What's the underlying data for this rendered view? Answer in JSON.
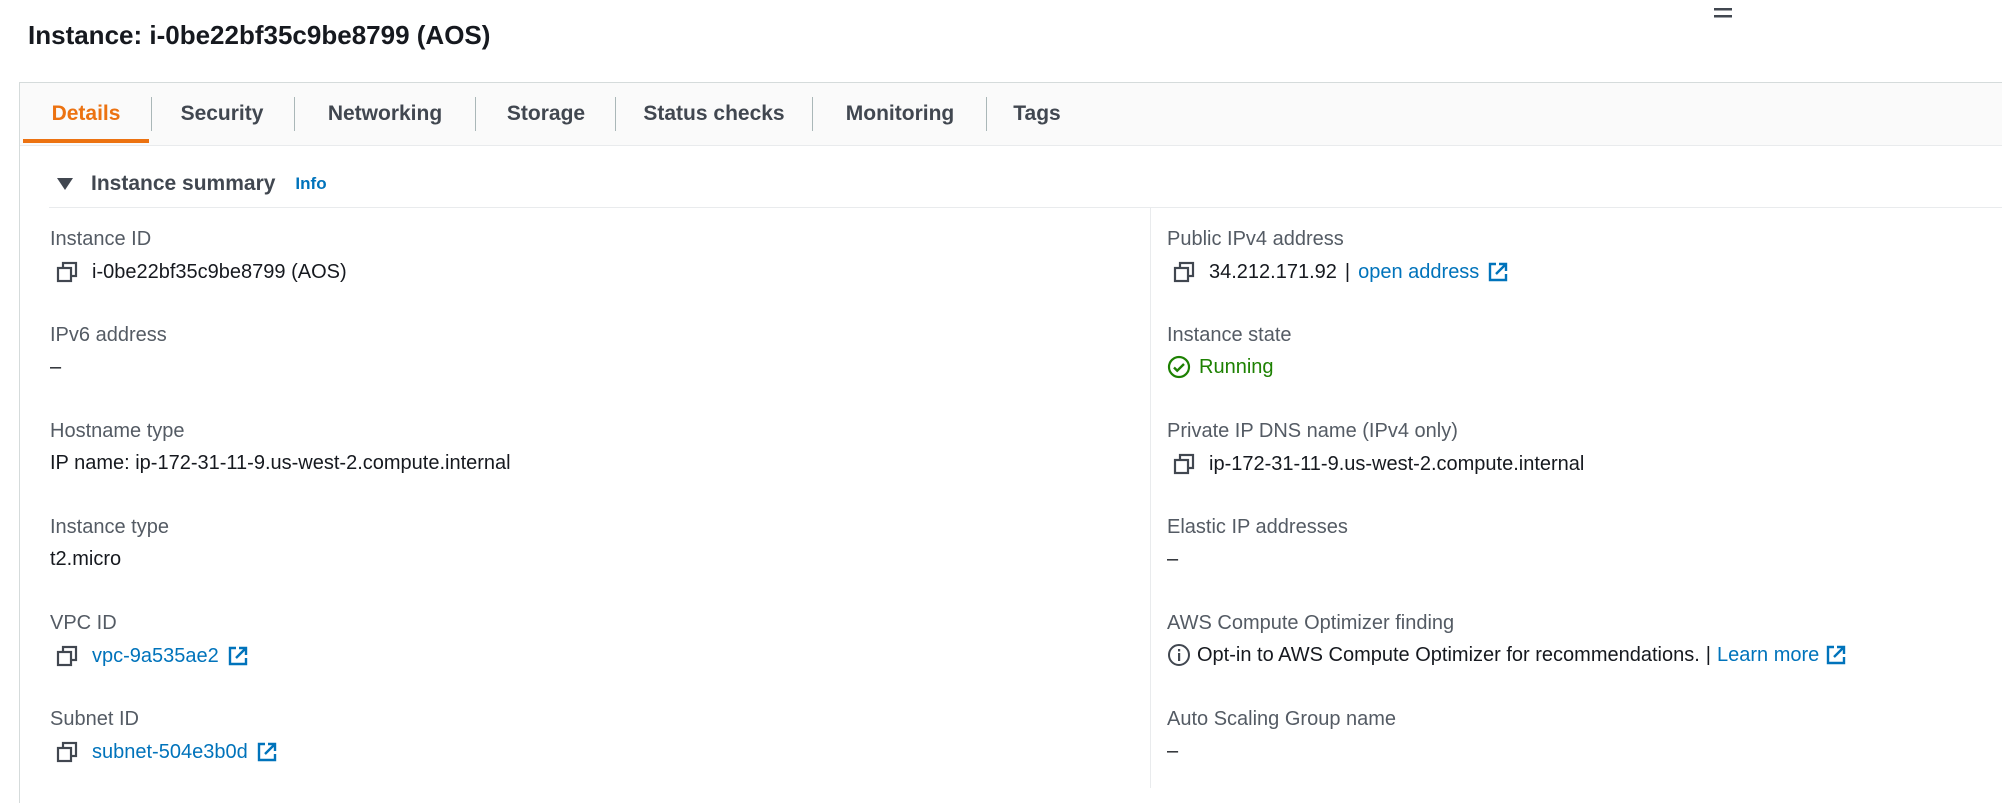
{
  "page": {
    "title": "Instance: i-0be22bf35c9be8799 (AOS)"
  },
  "tabs": [
    {
      "label": "Details",
      "active": true
    },
    {
      "label": "Security",
      "active": false
    },
    {
      "label": "Networking",
      "active": false
    },
    {
      "label": "Storage",
      "active": false
    },
    {
      "label": "Status checks",
      "active": false
    },
    {
      "label": "Monitoring",
      "active": false
    },
    {
      "label": "Tags",
      "active": false
    }
  ],
  "summary": {
    "title": "Instance summary",
    "info": "Info"
  },
  "left": {
    "instance_id": {
      "label": "Instance ID",
      "value": "i-0be22bf35c9be8799 (AOS)"
    },
    "ipv6": {
      "label": "IPv6 address",
      "value": "–"
    },
    "hostname_type": {
      "label": "Hostname type",
      "value": "IP name: ip-172-31-11-9.us-west-2.compute.internal"
    },
    "instance_type": {
      "label": "Instance type",
      "value": "t2.micro"
    },
    "vpc": {
      "label": "VPC ID",
      "value": "vpc-9a535ae2"
    },
    "subnet": {
      "label": "Subnet ID",
      "value": "subnet-504e3b0d"
    }
  },
  "right": {
    "public_ipv4": {
      "label": "Public IPv4 address",
      "value": "34.212.171.92",
      "separator": "|",
      "link": "open address"
    },
    "state": {
      "label": "Instance state",
      "value": "Running"
    },
    "private_dns": {
      "label": "Private IP DNS name (IPv4 only)",
      "value": "ip-172-31-11-9.us-west-2.compute.internal"
    },
    "elastic_ip": {
      "label": "Elastic IP addresses",
      "value": "–"
    },
    "optimizer": {
      "label": "AWS Compute Optimizer finding",
      "value": "Opt-in to AWS Compute Optimizer for recommendations.",
      "separator": "|",
      "link": "Learn more"
    },
    "asg": {
      "label": "Auto Scaling Group name",
      "value": "–"
    }
  },
  "colors": {
    "accent": "#ec7211",
    "link": "#0073bb",
    "success": "#1d8102"
  }
}
